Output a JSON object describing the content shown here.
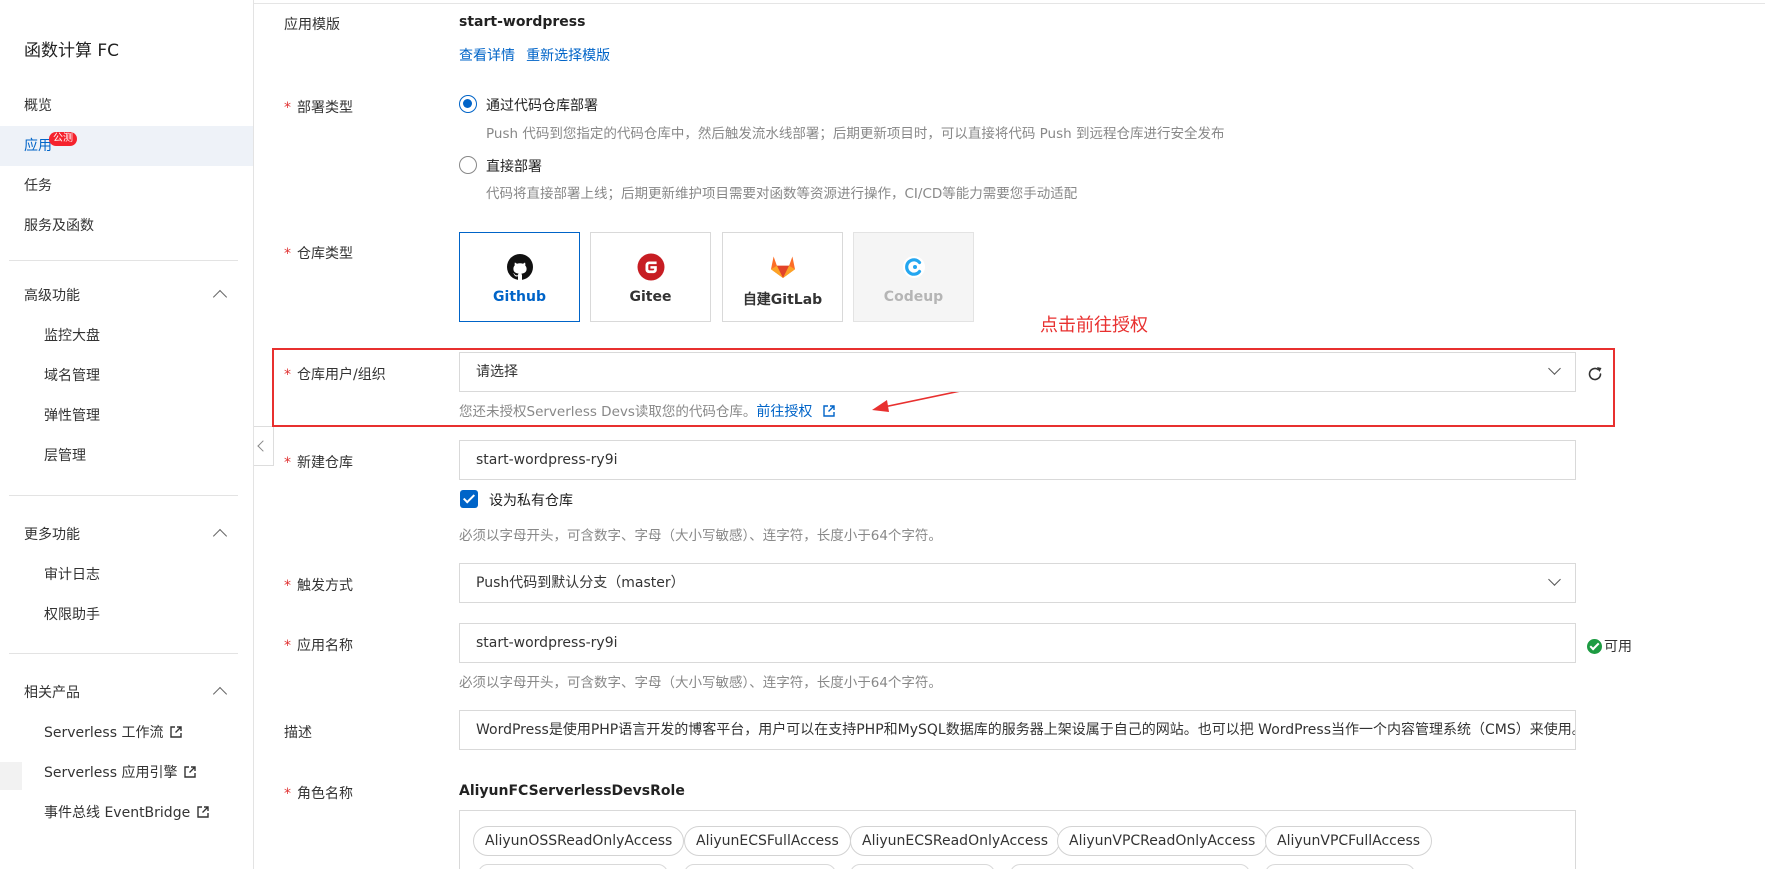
{
  "sidebar": {
    "title": "函数计算 FC",
    "items": [
      {
        "label": "概览"
      },
      {
        "label": "应用",
        "badge": "公测",
        "active": true
      },
      {
        "label": "任务"
      },
      {
        "label": "服务及函数"
      }
    ],
    "sections": [
      {
        "label": "高级功能",
        "items": [
          "监控大盘",
          "域名管理",
          "弹性管理",
          "层管理"
        ]
      },
      {
        "label": "更多功能",
        "items": [
          "审计日志",
          "权限助手"
        ]
      },
      {
        "label": "相关产品",
        "items": [
          "Serverless 工作流",
          "Serverless 应用引擎",
          "事件总线 EventBridge"
        ]
      }
    ]
  },
  "form": {
    "template": {
      "label": "应用模版",
      "value": "start-wordpress",
      "view_details": "查看详情",
      "reselect": "重新选择模版"
    },
    "deploy_type": {
      "label": "部署类型",
      "options": [
        {
          "label": "通过代码仓库部署",
          "desc": "Push 代码到您指定的代码仓库中，然后触发流水线部署；后期更新项目时，可以直接将代码 Push 到远程仓库进行安全发布",
          "checked": true
        },
        {
          "label": "直接部署",
          "desc": "代码将直接部署上线；后期更新维护项目需要对函数等资源进行操作，CI/CD等能力需要您手动适配",
          "checked": false
        }
      ]
    },
    "repo_type": {
      "label": "仓库类型",
      "options": [
        {
          "label": "Github",
          "icon": "github-icon",
          "selected": true
        },
        {
          "label": "Gitee",
          "icon": "gitee-icon"
        },
        {
          "label": "自建GitLab",
          "icon": "gitlab-icon"
        },
        {
          "label": "Codeup",
          "icon": "codeup-icon",
          "disabled": true
        }
      ]
    },
    "repo_owner": {
      "label": "仓库用户/组织",
      "placeholder": "请选择",
      "hint": "您还未授权Serverless Devs读取您的代码仓库。",
      "auth_link": "前往授权"
    },
    "new_repo": {
      "label": "新建仓库",
      "value": "start-wordpress-ry9i",
      "private_label": "设为私有仓库",
      "private_checked": true,
      "hint": "必须以字母开头，可含数字、字母（大小写敏感）、连字符，长度小于64个字符。"
    },
    "trigger": {
      "label": "触发方式",
      "value": "Push代码到默认分支（master）"
    },
    "app_name": {
      "label": "应用名称",
      "value": "start-wordpress-ry9i",
      "status": "可用",
      "hint": "必须以字母开头，可含数字、字母（大小写敏感）、连字符，长度小于64个字符。"
    },
    "description": {
      "label": "描述",
      "value": "WordPress是使用PHP语言开发的博客平台，用户可以在支持PHP和MySQL数据库的服务器上架设属于自己的网站。也可以把 WordPress当作一个内容管理系统（CMS）来使用。"
    },
    "role": {
      "label": "角色名称",
      "value": "AliyunFCServerlessDevsRole",
      "policies": [
        "AliyunOSSReadOnlyAccess",
        "AliyunECSFullAccess",
        "AliyunECSReadOnlyAccess",
        "AliyunVPCReadOnlyAccess",
        "AliyunVPCFullAccess"
      ]
    }
  },
  "annotation": {
    "text": "点击前往授权",
    "color": "#e8302f"
  },
  "colors": {
    "primary": "#0064c8",
    "required": "#e03030",
    "success": "#1d9b42",
    "accent": "#ff6a00"
  }
}
